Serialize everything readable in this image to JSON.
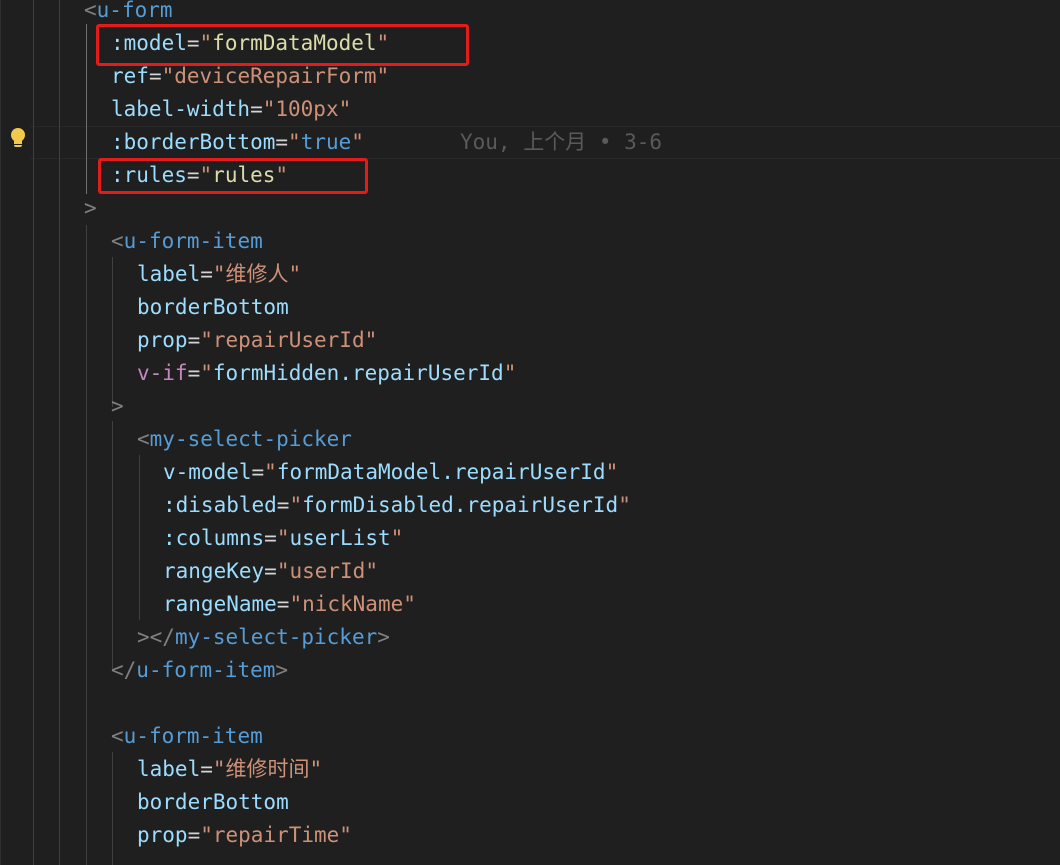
{
  "code_lines": [
    [
      [
        "punct",
        "<"
      ],
      [
        "tag",
        "u-form"
      ]
    ],
    [
      [
        "attr",
        ":model"
      ],
      [
        "op",
        "="
      ],
      [
        "str",
        "\""
      ],
      [
        "ident",
        "formDataModel"
      ],
      [
        "str",
        "\""
      ]
    ],
    [
      [
        "attr",
        "ref"
      ],
      [
        "op",
        "="
      ],
      [
        "str",
        "\"deviceRepairForm\""
      ]
    ],
    [
      [
        "attr",
        "label-width"
      ],
      [
        "op",
        "="
      ],
      [
        "str",
        "\"100px\""
      ]
    ],
    [
      [
        "attr",
        ":borderBottom"
      ],
      [
        "op",
        "="
      ],
      [
        "str",
        "\""
      ],
      [
        "tag",
        "true"
      ],
      [
        "str",
        "\""
      ]
    ],
    [
      [
        "attr",
        ":rules"
      ],
      [
        "op",
        "="
      ],
      [
        "str",
        "\""
      ],
      [
        "ident",
        "rules"
      ],
      [
        "str",
        "\""
      ]
    ],
    [
      [
        "punct",
        ">"
      ]
    ],
    [
      [
        "punct",
        "<"
      ],
      [
        "tag",
        "u-form-item"
      ]
    ],
    [
      [
        "attr",
        "label"
      ],
      [
        "op",
        "="
      ],
      [
        "str",
        "\"维修人\""
      ]
    ],
    [
      [
        "attr",
        "borderBottom"
      ]
    ],
    [
      [
        "attr",
        "prop"
      ],
      [
        "op",
        "="
      ],
      [
        "str",
        "\"repairUserId\""
      ]
    ],
    [
      [
        "dir",
        "v-if"
      ],
      [
        "op",
        "="
      ],
      [
        "str",
        "\""
      ],
      [
        "attr",
        "formHidden.repairUserId"
      ],
      [
        "str",
        "\""
      ]
    ],
    [
      [
        "punct",
        ">"
      ]
    ],
    [
      [
        "punct",
        "<"
      ],
      [
        "tag",
        "my-select-picker"
      ]
    ],
    [
      [
        "attr",
        "v-model"
      ],
      [
        "op",
        "="
      ],
      [
        "str",
        "\""
      ],
      [
        "attr",
        "formDataModel.repairUserId"
      ],
      [
        "str",
        "\""
      ]
    ],
    [
      [
        "attr",
        ":disabled"
      ],
      [
        "op",
        "="
      ],
      [
        "str",
        "\""
      ],
      [
        "attr",
        "formDisabled.repairUserId"
      ],
      [
        "str",
        "\""
      ]
    ],
    [
      [
        "attr",
        ":columns"
      ],
      [
        "op",
        "="
      ],
      [
        "str",
        "\""
      ],
      [
        "attr",
        "userList"
      ],
      [
        "str",
        "\""
      ]
    ],
    [
      [
        "attr",
        "rangeKey"
      ],
      [
        "op",
        "="
      ],
      [
        "str",
        "\"userId\""
      ]
    ],
    [
      [
        "attr",
        "rangeName"
      ],
      [
        "op",
        "="
      ],
      [
        "str",
        "\"nickName\""
      ]
    ],
    [
      [
        "punct",
        "></"
      ],
      [
        "tag",
        "my-select-picker"
      ],
      [
        "punct",
        ">"
      ]
    ],
    [
      [
        "punct",
        "</"
      ],
      [
        "tag",
        "u-form-item"
      ],
      [
        "punct",
        ">"
      ]
    ],
    [],
    [
      [
        "punct",
        "<"
      ],
      [
        "tag",
        "u-form-item"
      ]
    ],
    [
      [
        "attr",
        "label"
      ],
      [
        "op",
        "="
      ],
      [
        "str",
        "\"维修时间\""
      ]
    ],
    [
      [
        "attr",
        "borderBottom"
      ]
    ],
    [
      [
        "attr",
        "prop"
      ],
      [
        "op",
        "="
      ],
      [
        "str",
        "\"repairTime\""
      ]
    ]
  ],
  "blame": {
    "text": "You, 上个月 • 3-6"
  },
  "colors": {
    "background": "#1f1f1f",
    "tag": "#569cd6",
    "attribute": "#9cdcfe",
    "string": "#ce9178",
    "identifier": "#dcdcaa",
    "directive": "#c586c0",
    "punctuation": "#808080",
    "highlight_box": "#e31b1b",
    "lightbulb": "#f2c94c"
  },
  "icons": {
    "lightbulb": "lightbulb-icon"
  }
}
